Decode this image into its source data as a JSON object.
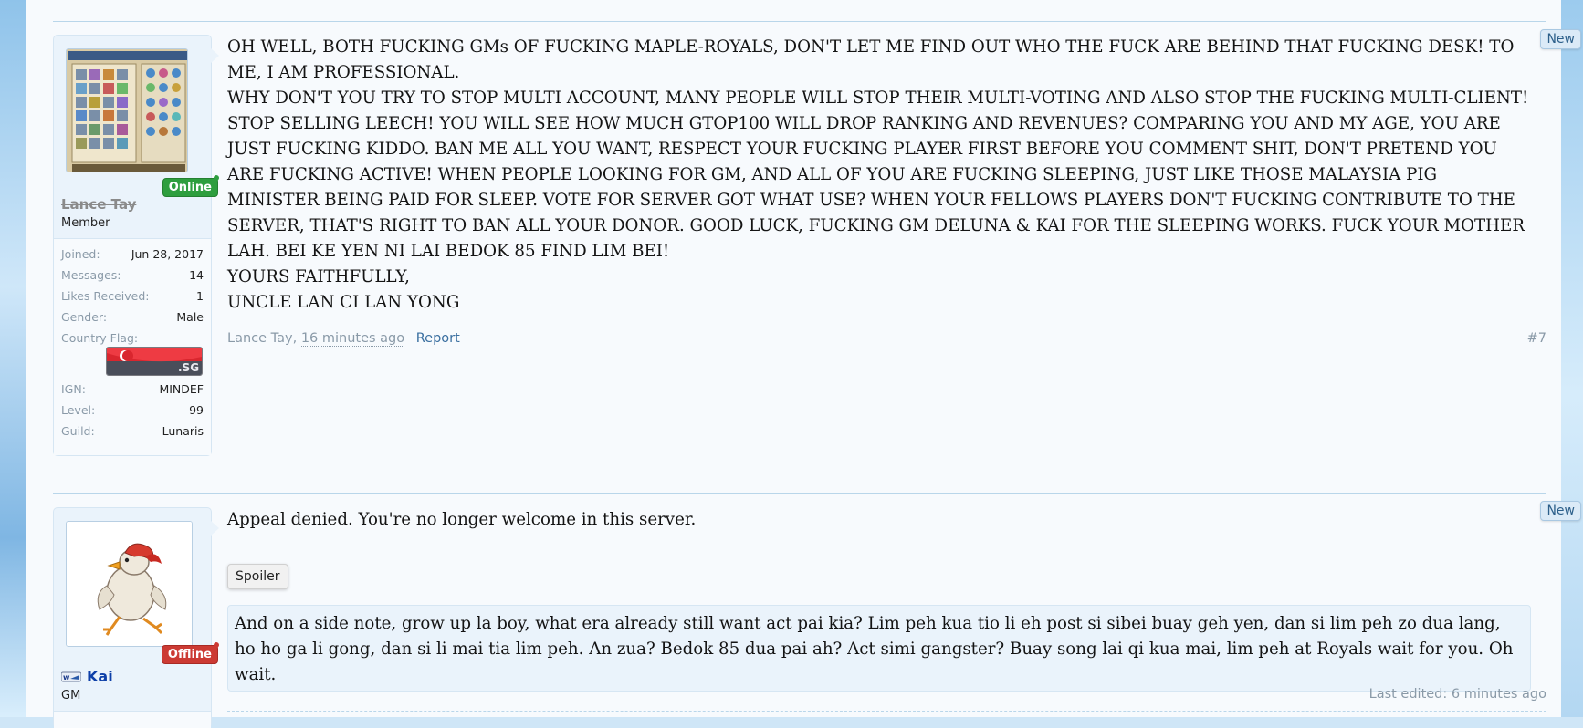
{
  "posts": [
    {
      "user": {
        "name": "Lance Tay",
        "title": "Member",
        "status": "Online",
        "info": [
          {
            "label": "Joined:",
            "value": "Jun 28, 2017"
          },
          {
            "label": "Messages:",
            "value": "14"
          },
          {
            "label": "Likes Received:",
            "value": "1"
          },
          {
            "label": "Gender:",
            "value": "Male"
          },
          {
            "label": "Country Flag:",
            "value": ""
          },
          {
            "label": "IGN:",
            "value": "MINDEF"
          },
          {
            "label": "Level:",
            "value": "-99"
          },
          {
            "label": "Guild:",
            "value": "Lunaris"
          }
        ],
        "flag_text": ".SG"
      },
      "body": [
        "OH WELL, BOTH FUCKING GMs OF FUCKING MAPLE-ROYALS, DON'T LET ME FIND OUT WHO THE FUCK ARE BEHIND THAT FUCKING DESK! TO ME, I AM PROFESSIONAL.",
        "WHY DON'T YOU TRY TO STOP MULTI ACCOUNT, MANY PEOPLE WILL STOP THEIR MULTI-VOTING AND ALSO STOP THE FUCKING MULTI-CLIENT! STOP SELLING LEECH! YOU WILL SEE HOW MUCH GTOP100 WILL DROP RANKING AND REVENUES? COMPARING YOU AND MY AGE, YOU ARE JUST FUCKING KIDDO. BAN ME ALL YOU WANT, RESPECT YOUR FUCKING PLAYER FIRST BEFORE YOU COMMENT SHIT, DON'T PRETEND YOU ARE FUCKING ACTIVE! WHEN PEOPLE LOOKING FOR GM, AND ALL OF YOU ARE FUCKING SLEEPING, JUST LIKE THOSE MALAYSIA PIG MINISTER BEING PAID FOR SLEEP. VOTE FOR SERVER GOT WHAT USE? WHEN YOUR FELLOWS PLAYERS DON'T FUCKING CONTRIBUTE TO THE SERVER, THAT'S RIGHT TO BAN ALL YOUR DONOR. GOOD LUCK, FUCKING GM DELUNA & KAI FOR THE SLEEPING WORKS. FUCK YOUR MOTHER LAH. BEI KE YEN NI LAI BEDOK 85 FIND LIM BEI!",
        "YOURS FAITHFULLY,",
        "UNCLE LAN CI LAN YONG"
      ],
      "footer": {
        "author": "Lance Tay,",
        "time": "16 minutes ago",
        "report": "Report",
        "post_number": "#7"
      },
      "new_badge": "New"
    },
    {
      "user": {
        "name": "Kai",
        "title": "GM",
        "status": "Offline"
      },
      "body": [
        "Appeal denied. You're no longer welcome in this server."
      ],
      "spoiler_label": "Spoiler",
      "spoiler_text": "And on a side note, grow up la boy, what era already still want act pai kia? Lim peh kua tio li eh post si sibei buay geh yen, dan si lim peh zo dua lang, ho ho ga li gong, dan si li mai tia lim peh. An zua? Bedok 85 dua pai ah? Act simi gangster? Buay song lai qi kua mai, lim peh at Royals wait for you. Oh wait.",
      "footer": {
        "last_edited_label": "Last edited:",
        "last_edited_time": "6 minutes ago"
      },
      "new_badge": "New"
    }
  ],
  "colors": {
    "online": "#2e9e3e",
    "offline": "#cc3a33",
    "username_gm": "#0d3fa8",
    "username_banned": "#8a8a8a"
  }
}
